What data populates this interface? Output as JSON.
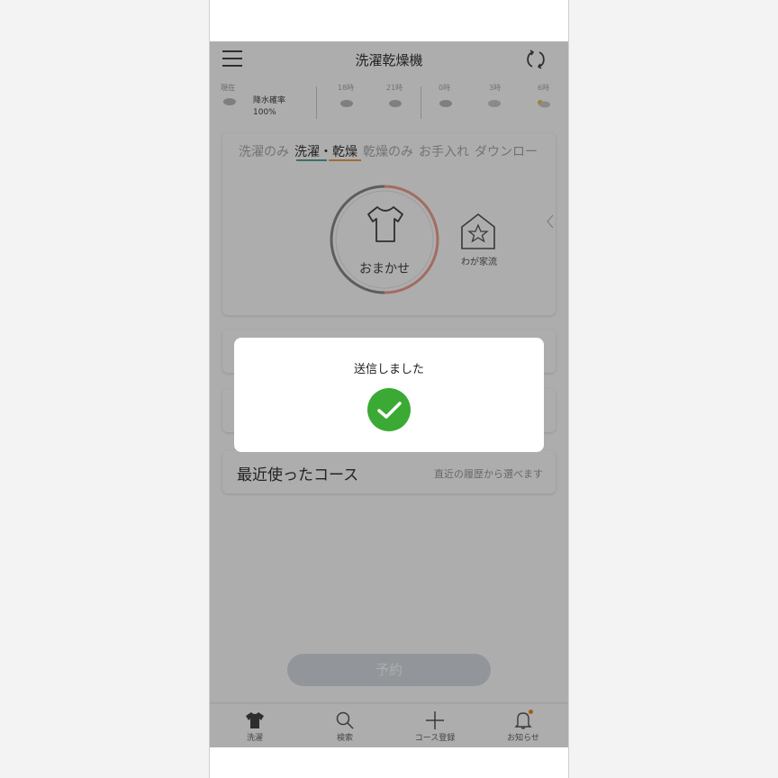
{
  "header": {
    "title": "洗濯乾燥機"
  },
  "weather": {
    "now_label": "現在",
    "rain_label": "降水確率",
    "rain_value": "100%",
    "hours": [
      "18時",
      "21時",
      "0時",
      "3時",
      "6時"
    ]
  },
  "course": {
    "tabs": [
      "洗濯のみ",
      "洗濯・乾燥",
      "乾燥のみ",
      "お手入れ",
      "ダウンロー"
    ],
    "active_tab": "洗濯・乾燥",
    "dial_label": "おまかせ",
    "house_label": "わが家流"
  },
  "recent": {
    "label": "最近使ったコース",
    "hint": "直近の履歴から選べます"
  },
  "reserve_button": "予約",
  "bottom_nav": {
    "items": [
      {
        "label": "洗濯",
        "icon": "shirt-icon"
      },
      {
        "label": "検索",
        "icon": "search-icon"
      },
      {
        "label": "コース登録",
        "icon": "plus-icon"
      },
      {
        "label": "お知らせ",
        "icon": "bell-icon"
      }
    ]
  },
  "dialog": {
    "message": "送信しました"
  },
  "colors": {
    "accent_green": "#3aaa35",
    "dial_gray": "#8a8a8a",
    "dial_salmon": "#f0a090",
    "tab_underline_green": "#5aa39a",
    "tab_underline_orange": "#f0a050",
    "notification_dot": "#f08a24"
  }
}
